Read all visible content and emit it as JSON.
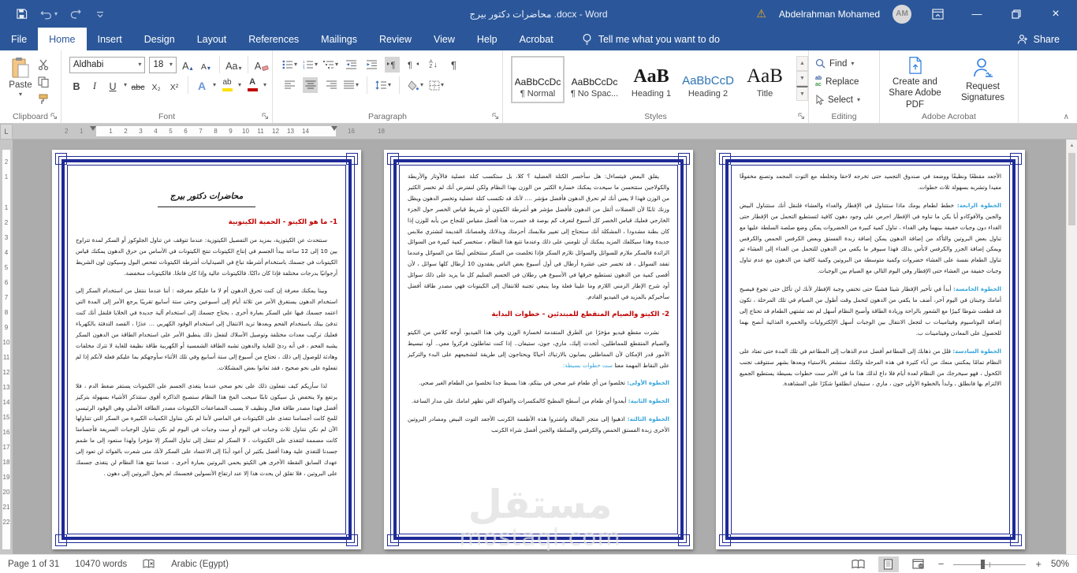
{
  "titlebar": {
    "title": "محاضرات دكتور بيرج .docx  -  Word",
    "user": "Abdelrahman Mohamed",
    "avatar_initials": "AM"
  },
  "tabs": {
    "file": "File",
    "home": "Home",
    "insert": "Insert",
    "design": "Design",
    "layout": "Layout",
    "references": "References",
    "mailings": "Mailings",
    "review": "Review",
    "view": "View",
    "help": "Help",
    "acrobat": "Acrobat",
    "tell_me": "Tell me what you want to do",
    "share": "Share"
  },
  "ribbon": {
    "clipboard": {
      "paste": "Paste",
      "label": "Clipboard"
    },
    "font": {
      "font_name": "Aldhabi",
      "font_size": "18",
      "bold": "B",
      "italic": "I",
      "underline": "U",
      "strike": "abc",
      "subscript": "X₂",
      "superscript": "X²",
      "grow": "A",
      "shrink": "A",
      "case": "Aa",
      "clear": "A",
      "effects": "A",
      "highlight": "ab",
      "color": "A",
      "label": "Font"
    },
    "paragraph": {
      "label": "Paragraph",
      "sort_a": "A",
      "sort_z": "Z"
    },
    "styles": {
      "label": "Styles",
      "items": [
        {
          "preview": "AaBbCcDc",
          "name": "¶ Normal"
        },
        {
          "preview": "AaBbCcDc",
          "name": "¶ No Spac..."
        },
        {
          "preview": "AaB",
          "name": "Heading 1"
        },
        {
          "preview": "AaBbCcD",
          "name": "Heading 2"
        },
        {
          "preview": "AaB",
          "name": "Title"
        }
      ]
    },
    "editing": {
      "find": "Find",
      "replace": "Replace",
      "select": "Select",
      "label": "Editing",
      "replace_ab": "ab",
      "replace_ac": "ac"
    },
    "acrobat": {
      "create_share": "Create and Share Adobe PDF",
      "request_sig": "Request Signatures",
      "label": "Adobe Acrobat"
    }
  },
  "ruler": {
    "h_left": [
      "2",
      "1"
    ],
    "h_main": [
      "1",
      "2",
      "3",
      "4",
      "5",
      "6",
      "7",
      "8",
      "9",
      "10",
      "11",
      "12",
      "13",
      "14"
    ],
    "h_right": [
      "16",
      "18"
    ],
    "v_top": [
      "2",
      "1"
    ],
    "v_main": [
      "1",
      "2",
      "3",
      "4",
      "5",
      "6",
      "7",
      "8",
      "9",
      "10",
      "11",
      "12",
      "13",
      "14",
      "15",
      "16",
      "17",
      "18",
      "19",
      "20",
      "21",
      "22"
    ]
  },
  "pages": {
    "p1": {
      "script_title": "محاضرات دكتور بيرج",
      "heading": "1- ما هو الكيتو - الحمية الكيتونية",
      "para1": "سنتحدث عن الكيتوزية، بمزيد من التفصيل الكيتوزية: عندما تتوقف عن تناول الجلوكوز أو السكر لمدة تتراوح بين 10 إلى 12 ساعة يبدأ الجسم في إنتاج الكيتونات تنتج الكيتونات في الأساس من حرق الدهون يمكنك قياس الكيتونات في جسمك باستخدام أشرطة تباع في الصيدليات أشرطة الكيتونات تفحص البول وسيكون لون الشريط أرجوانيًا بدرجات مختلفة فإذا كان داكنًا. فالكيتونات عالية وإذا كان فاتحًا. فالكيتونات منخفضة.",
      "para2": "وبينا يمكنك معرفة إن كنت تحرق الدهون أم لا ما عليكم معرفته : أننا عندما ننتقل من استخدام السكر إلى استخدام الدهون يستغرق الأمر من ثلاثة أيام إلى أسبوعين وحتى ستة أسابيع تقريبًا يرجع الأمر إلى المدة التي اعتمد جسمك فيها على السكر بعبارة أخرى ، يحتاج جسمك إلى استخدام آلية جديدة في الخلايا فلنقل أنك كنت تدفئ بيتك باستخدام الفحم وبعدها تريد الانتقال إلى استخدام الوقود الكهربي … عذرًا ، القصد التدفئة بالكهرباء فعليك تركيب معدات مختلفة وتوصيل الأسلاك لتفعل ذلك ينطبق الأمر على استخدام الطاقة من الدهون السكر يشبه الفحم ، في أنه ردئ للغاية والدهون تشبه الطاقة الشمسية أو الكهربية طاقة نظيفة للغاية لا تترك مخلفات وهادئة للوصول إلى ذلك ، تحتاج من أسبوع إلى ستة أسابيع وفي تلك الأثناء سأوجهكم بما عليكم فعله لأنكم إذا لم تفعلوه على نحو صحيح ، فقد تعانوا بعض المشكلات.",
      "para3": "لذا سأريكم كيف تفعلون ذلك على نحو صحي عندما يتغذى الجسم على الكيتونات يستقر ضغط الدم ، فلا يرتفع ولا ينخفض بل سيكون ثابتًا سيحب المخ هذا النظام ستصبح الذاكرة أقوى ستتذكر الأشياء بسهولة بتركيز أفضل فهذا مصدر طاقة فعال ونظيف لا يسبب المضاعفات الكيتونات مصدر الطاقة الأصلي وهي الوقود الرئيسي للمخ كانت أجسامنا تتغذى على الكيتونات في الماضي لأننا لم نكن نتناول الكميات الكبيرة من السكر التي تتناولها الآن لم نكن نتناول ثلاث وجبات في اليوم أو ست وجبات في اليوم لم نكن نتناول الوجبات السريعة فأجسامنا كانت مصممة لتتغذى على الكيتونات ، لا السكر لم تنتقل إلى تناول السكر إلا مؤخرا ولهذا ستعود إلى ما صُمم جسدنا للتغذي علية وهذا أفضل بكثير لن أعود أبدًا إلى الاعتماد على السكر لأنك متى شعرت بالفوائد لن تعود إلى عهدك السابق النقطة الأخرى هي الكيتو يحمي البروتين بعبارة أخرى ، عندما تتبع هذا النظام لن يتغذى جسمك على البروتين ، فلا تقلق لن يحدث هذا إلا عند ارتفاع الأنسولين فجسمك لم يحول البروتين إلى دهون ."
    },
    "p2": {
      "para1": "يقلق البعض فيتساءل: هل سأخسر الكتلة العضلية ؟ كلا، بل ستكسب كتلة عضلية فالأوتار والأربطة والكولاجين ستتحسن ما سيحدث يمكنك خسارة الكثير من الوزن بهذا النظام ولكن لنفترض أنك لم تخسر الكثير من الوزن فهذا لا يعني أنك لم تحرق الدهون فأفضل مؤشر …. لأنك قد تكتسب كتلة عضلية وتخسر الدهون ويظل وزنك ثابتًا لأن العضلات أثقل من الدهون فأفضل مؤشر هو أشرطة الكيتون أو شريط قياس الخصر حول الجزء الخارجي فعليك قياس الخصر كل أسبوع لتعرف كم بوصة قد خسرت هذا أفضل مقياس للنجاح من يأبه للوزن إذا كان بطنة مشدودا ، المشكلة أنك ستحتاج إلى تغيير ملابسك أحزمتك وبذلاتك وقمصانك القديمة لتشتري ملابس جديدة وهذا سيكلفك المزيد يمكنك أن تلومني على ذلك وعندما تتبع هذا النظام ، ستخسر كمية كبيرة من السوائل الزائدة فالسكر ملازم للسوائل والسوائل تلازم السكر فإذا تخلصت من السكر ستتخلص أيضًا من السوائل وعندما تفقد السوائل ، قد تخسر حتى عشرة أرطال في أول أسبوع بعض الناس يفقدون 10 أرطال كلها سوائل ، لأن أقصى كمية من الدهون تستطيع حرقها في الأسبوع هي رطلان في الجسم السليم كل ما يزيد على ذلك سوائل أود شرح الإطار الزمني اللازم وما علينا فعلة وما ينبغي تجنبه للانتقال إلى الكيتونات فهي مصدر طاقة أفضل سأخبركم بالمزيد في الفيديو القادم.",
      "heading": "2- الكيتو والصيام المتقطع للمبتدئين - خطوات البداية",
      "para2": "نشرت مقطع فيديو مؤخرًا عن الطرق المتقدمة لخسارة الوزن وفي هذا الفيديو، أوجه كلامي من الكيتو والصيام المتقطع للمماطلين، أتحدث إليك، ماري، جون، ستيفان.. إذا كنت تماطلون فركزوا معي.. أود تبسيط الأمور قدر الإمكان لأن المماطلين يصابون بالارتباك أحيانًا ويحتاجون إلى طريقة لتشجيعهم على البدء والتركيز على النقاط المهمة معنا",
      "para2_highlight": "ست خطوات بسيطة:",
      "step1": {
        "label": "الخطوة الأولى:",
        "text": "تخلصوا من أي طعام غير صحي في بيتكم، هذا بسيط جدا تخلصوا من الطعام الغير صحي."
      },
      "step2": {
        "label": "الخطوة الثانية:",
        "text": "أبعدوا أي طعام من أسطح المطبخ كالمكسرات والفواكه التي تظهر امامك على مدار الساعة."
      },
      "step3": {
        "label": "الخطوة الثالثة:",
        "text": "اذهبوا إلى متجر البقالة واشتروا هذه الأطعمة الكرنب الأجعد التوت البيض ومصادر البروتين الأخرى زبدة الفستق الحمص والكرفس والسلطة والجبن أفضل شراء الكرنب"
      }
    },
    "p3": {
      "para1": "الأجعد مقطعًا ونظيفًا ووضعة في صندوق التجميد حتى تخرجه لاحقا وتخلطه مع التوت المجمد وتصنع مخفوقًا مفيدا وتشربه بسهولة ثلاث خطوات.",
      "step4": {
        "label": "الخطوة الرابعة:",
        "text": "خطط لطعام يومك ماذا ستتناول في الإفطار والغداء والعشاء فلنقل أنك ستتناول البيض والجبن والأفوكادو أيا يكن ما تناوه في الإفطار احرص على وجود دهون كافية لتستطيع التحمل من الإفطار حتى الغداء دون وجبات خفيفة بينهما وفي الغداء ، تناول كمية كبيرة من الخضروات يمكن وضع صلصة السلطة عليها مع تناول بعض البروتين والتأكد من إضافة الدهون يمكن إضافة زبدة الفستق وبعض الكرفس الحمص والكرفس ويمكن إضافة الجزر والكرفس لابأس بذلك فهذا سيوفر ما يكفي من الدهون للتحمل من الغداء إلى العشاء ثم تناول الطعام نفسة على العشاء خضروات وكمية متوسطة من البروتين وكمية كافية من الدهون مع عدم تناول وجبات خفيفة من العشاء حتى الإفطار وفي اليوم التالي مع الصيام بين الوجبات."
      },
      "step5": {
        "label": "الخطوة الخامسة:",
        "text": "أبدأ في تأخير الإفطار شيئا فشيئًا حتى تختفي وجبة الإفطار لأنك لن تأكل حتى تجوع فيصبح أمامك وجبتان في اليوم آخر، أضف ما يكفي من الدهون لتحمل وقت أطول من الصيام في تلك المرحلة ، تكون قد قطعت شوطا كبيرًا مع الشعور بالراحة وزيادة الطاقة وأصبح النظام أسهل لم تعد تشتهي الطعام قد تحتاج إلى إضافة البوتاسيوم وفيتامينات ب لتجعل الانتقال بين الوجبات أسهل الإلكتروليات والخميرة الغذائية أنصح بهما للحصول على المعادن وفيتامينات ب."
      },
      "step6": {
        "label": "الخطوة السادسة:",
        "text": "قلل من ذهابك إلى المطاعم أفضل عدم الذهاب إلى المطاعم في تلك المدة حتى تعتاد على النظام تمامًا يمكنني منعك من آباء كثيرة في هذه المرحلة ولكنك ستشعر بالاستياء وبعدها بشهر ستتوقف تجنب الكحول ، فهو سيخرجك من النظام لعدة أيام فلا داع لذلك هذا ما في الأمر ست خطوات بسيطة يستطيع الجميع الالتزام بها فانطلق ، وابدأ بالخطوة الأولى جون ، ماري ، ستيفان انطلقوا شكرًا على المشاهدة."
      }
    }
  },
  "watermark": {
    "text": "مستقل",
    "domain": "mostaql.com"
  },
  "statusbar": {
    "page": "Page 1 of 31",
    "words": "10470 words",
    "language": "Arabic (Egypt)",
    "zoom": "50%"
  },
  "icons": {
    "dropdown": "▾",
    "up_small": "▴",
    "warning": "⚠",
    "pilcrow": "¶",
    "arrow_down": "↓",
    "collapse_ribbon": "∧",
    "scroll_up": "▲",
    "scroll_down": "▼",
    "scroll_more": "▼",
    "minimize": "—",
    "close": "×",
    "zoom_out": "−",
    "zoom_in": "+",
    "sb_up": "▲",
    "tab_selector": "L"
  },
  "colors": {
    "accent": "#2b579a",
    "heading_red": "#c00000",
    "step_blue": "#33a3da",
    "page_border": "#1e2a96",
    "highlight_yellow": "#ffe100",
    "font_red": "#c00000"
  }
}
